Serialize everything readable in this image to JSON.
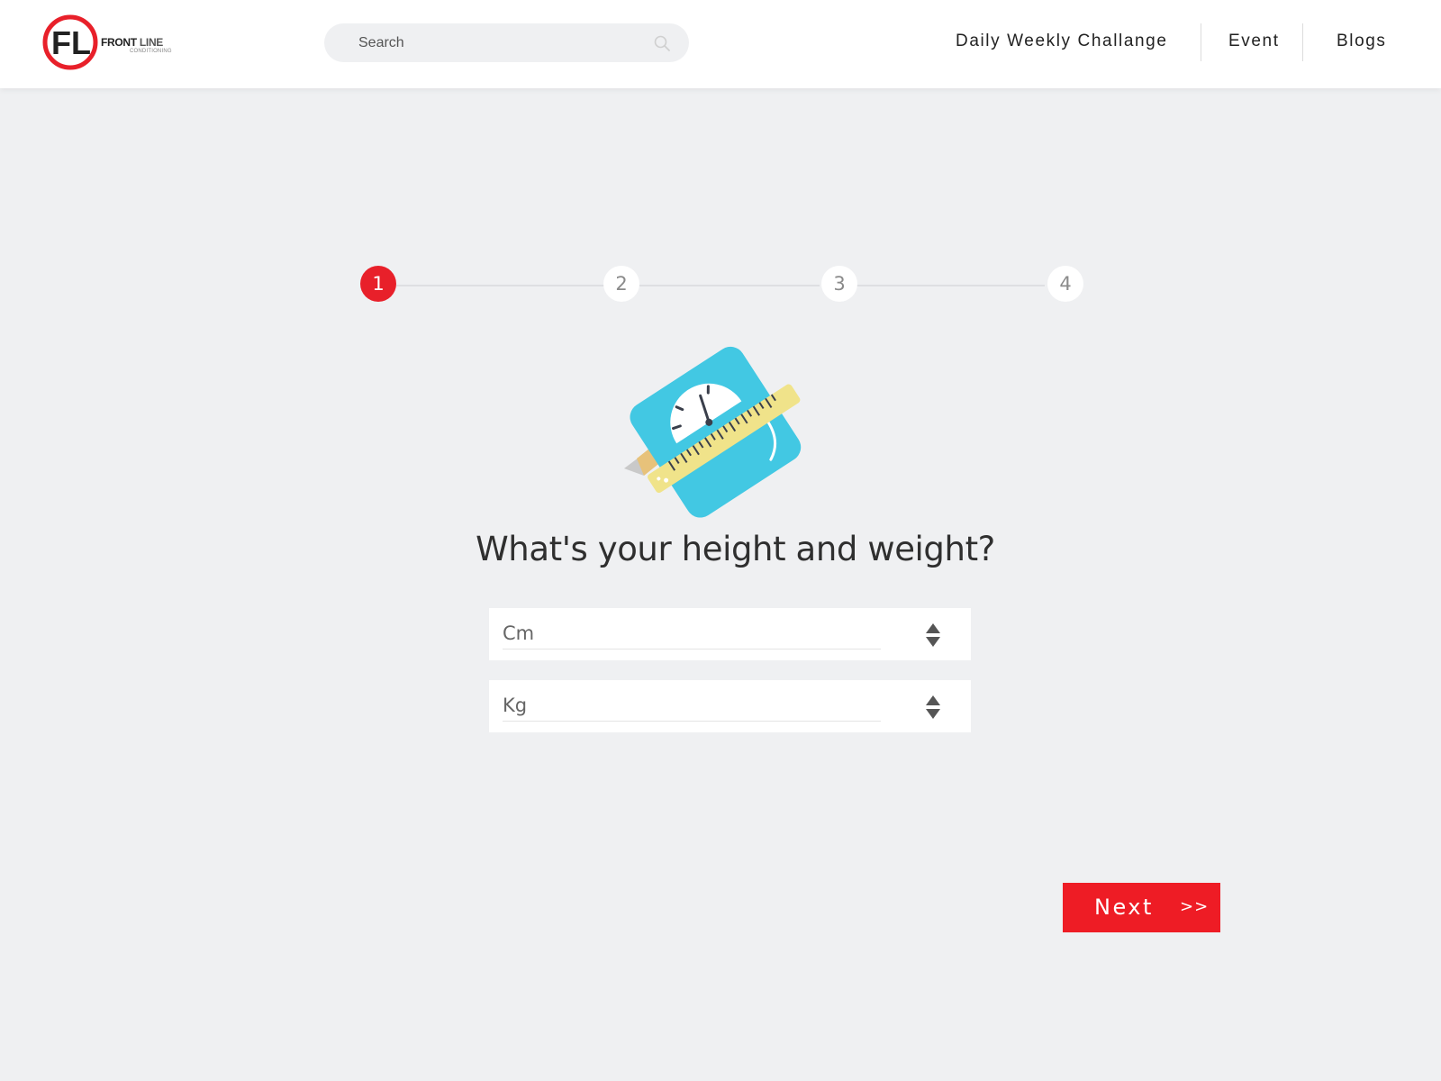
{
  "brand": {
    "logo_letters": "FL",
    "name_front": "FRONT",
    "name_line": "LINE",
    "tagline": "CONDITIONING",
    "accent_color": "#ee1c25"
  },
  "search": {
    "placeholder": "Search",
    "icon": "search-icon"
  },
  "nav": {
    "items": [
      {
        "label": "Daily Weekly Challange"
      },
      {
        "label": "Event"
      },
      {
        "label": "Blogs"
      }
    ]
  },
  "stepper": {
    "current_step": 1,
    "steps": [
      {
        "label": "1",
        "active": true
      },
      {
        "label": "2",
        "active": false
      },
      {
        "label": "3",
        "active": false
      },
      {
        "label": "4",
        "active": false
      }
    ]
  },
  "illustration": {
    "icon": "scale-with-measuring-tape-icon"
  },
  "question": {
    "title": "What's your height and weight?"
  },
  "fields": {
    "height": {
      "value": "Cm",
      "icon": "sort-arrows-icon"
    },
    "weight": {
      "value": "Kg",
      "icon": "sort-arrows-icon"
    }
  },
  "actions": {
    "next_label": "Next",
    "next_chevrons": ">>"
  }
}
